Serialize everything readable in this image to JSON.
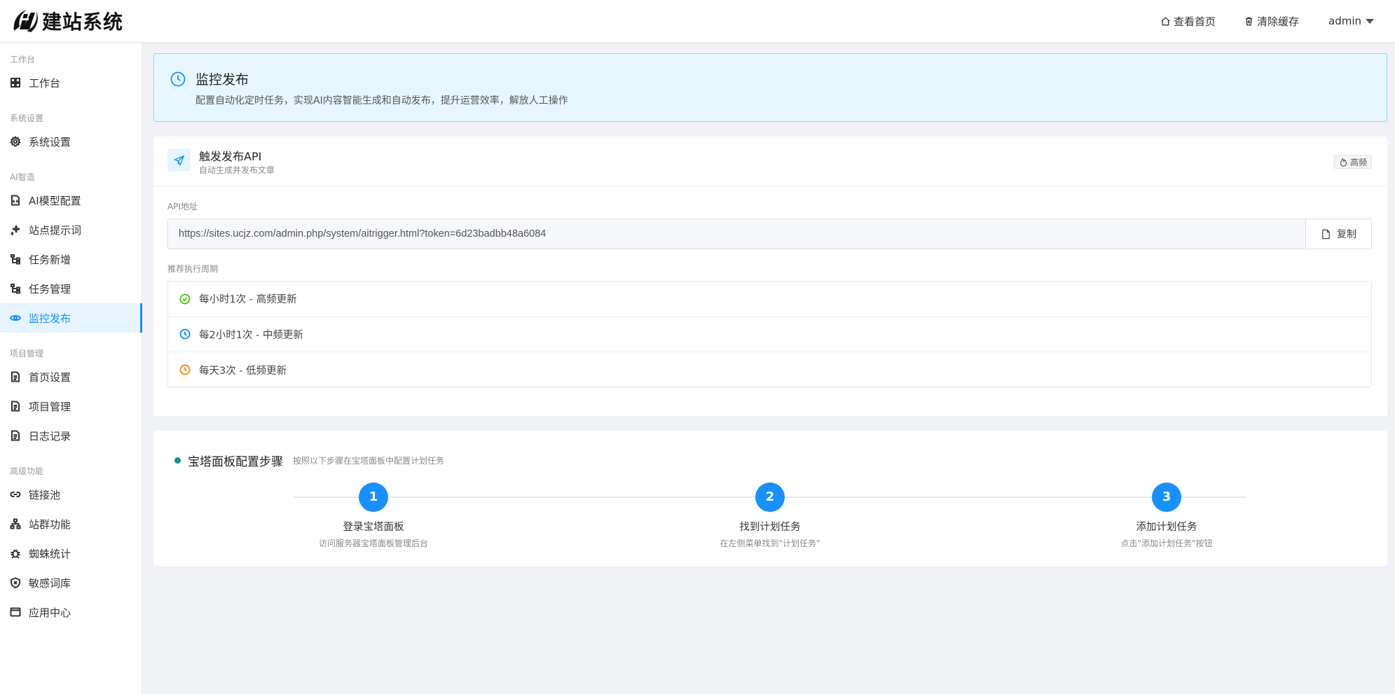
{
  "header": {
    "brand": "建站系统",
    "view_home": "查看首页",
    "clear_cache": "清除缓存",
    "user": "admin"
  },
  "sidebar": {
    "groups": [
      {
        "title": "工作台",
        "items": [
          {
            "label": "工作台",
            "icon": "dashboard-icon"
          }
        ]
      },
      {
        "title": "系统设置",
        "items": [
          {
            "label": "系统设置",
            "icon": "gear-icon"
          }
        ]
      },
      {
        "title": "AI智造",
        "items": [
          {
            "label": "AI模型配置",
            "icon": "file-code-icon"
          },
          {
            "label": "站点提示词",
            "icon": "sparkle-icon"
          },
          {
            "label": "任务新增",
            "icon": "tree-icon"
          },
          {
            "label": "任务管理",
            "icon": "tree-icon"
          },
          {
            "label": "监控发布",
            "icon": "eye-icon",
            "active": true
          }
        ]
      },
      {
        "title": "项目管理",
        "items": [
          {
            "label": "首页设置",
            "icon": "document-icon"
          },
          {
            "label": "项目管理",
            "icon": "document-icon"
          },
          {
            "label": "日志记录",
            "icon": "document-icon"
          }
        ]
      },
      {
        "title": "高级功能",
        "items": [
          {
            "label": "链接池",
            "icon": "link-icon"
          },
          {
            "label": "站群功能",
            "icon": "sitemap-icon"
          },
          {
            "label": "蜘蛛统计",
            "icon": "bug-icon"
          },
          {
            "label": "敏感词库",
            "icon": "shield-icon"
          },
          {
            "label": "应用中心",
            "icon": "window-icon"
          }
        ]
      }
    ]
  },
  "banner": {
    "title": "监控发布",
    "description": "配置自动化定时任务，实现AI内容智能生成和自动发布，提升运营效率，解放人工操作"
  },
  "api_card": {
    "title": "触发发布API",
    "subtitle": "自动生成并发布文章",
    "badge": "高频",
    "url_label": "API地址",
    "url": "https://sites.ucjz.com/admin.php/system/aitrigger.html?token=6d23badbb48a6084",
    "copy_label": "复制",
    "cycle_label": "推荐执行周期",
    "cycles": [
      {
        "label": "每小时1次 - 高频更新",
        "color": "#52c41a",
        "icon": "check-circle-icon"
      },
      {
        "label": "每2小时1次 - 中频更新",
        "color": "#1890ff",
        "icon": "clock-icon"
      },
      {
        "label": "每天3次 - 低频更新",
        "color": "#fa8c16",
        "icon": "clock-icon"
      }
    ]
  },
  "steps_card": {
    "title": "宝塔面板配置步骤",
    "subtitle": "按照以下步骤在宝塔面板中配置计划任务",
    "steps": [
      {
        "num": "1",
        "title": "登录宝塔面板",
        "desc": "访问服务器宝塔面板管理后台"
      },
      {
        "num": "2",
        "title": "找到计划任务",
        "desc": "在左侧菜单找到\"计划任务\""
      },
      {
        "num": "3",
        "title": "添加计划任务",
        "desc": "点击\"添加计划任务\"按钮"
      }
    ]
  },
  "colors": {
    "accent": "#1890ff",
    "banner_bg": "#e6f7ff",
    "step_dot": "#0e9488"
  }
}
